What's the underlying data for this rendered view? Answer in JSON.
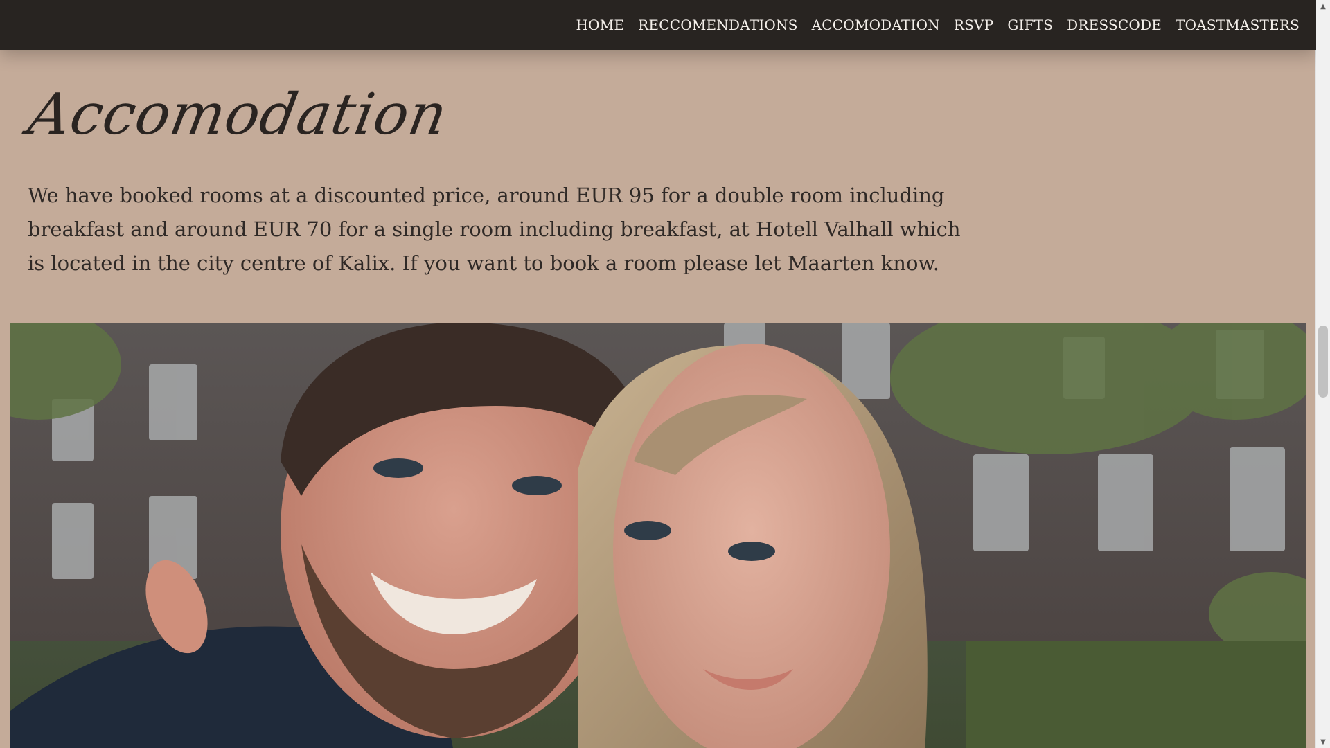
{
  "nav": {
    "items": [
      {
        "label": "HOME"
      },
      {
        "label": "RECCOMENDATIONS"
      },
      {
        "label": "ACCOMODATION"
      },
      {
        "label": "RSVP"
      },
      {
        "label": "GIFTS"
      },
      {
        "label": "DRESSCODE"
      },
      {
        "label": "TOASTMASTERS"
      }
    ]
  },
  "section": {
    "title": "Accomodation",
    "body": "We have booked rooms at a discounted price, around EUR 95 for a double room including breakfast and around EUR 70 for a single room including breakfast, at Hotell Valhall which is located in the city centre of Kalix. If you want to book a room please let Maarten know."
  },
  "colors": {
    "topbar": "#282421",
    "page_background": "#c4ab99",
    "text": "#2f2926",
    "nav_text": "#f4efea"
  },
  "scrollbar": {
    "up_icon": "triangle-up",
    "down_icon": "triangle-down"
  }
}
